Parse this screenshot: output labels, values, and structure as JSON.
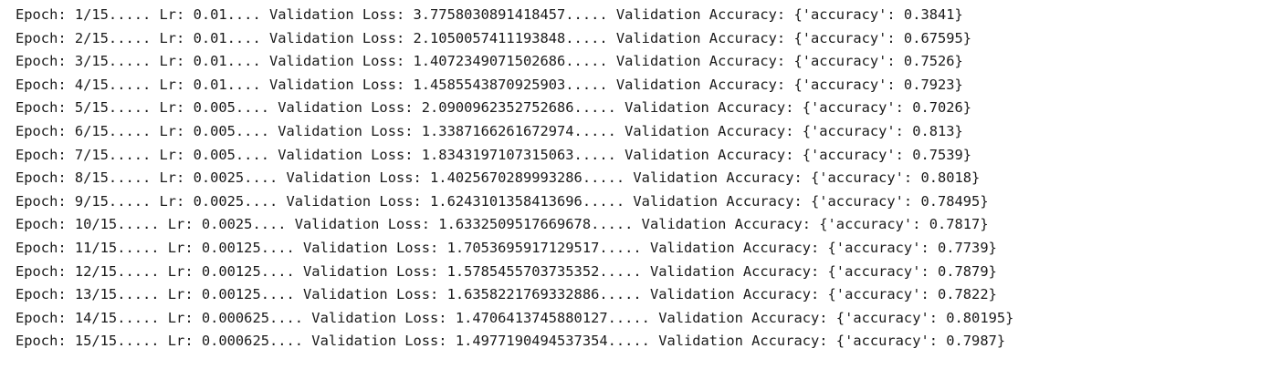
{
  "output": {
    "lines": [
      "Epoch: 1/15..... Lr: 0.01.... Validation Loss: 3.7758030891418457..... Validation Accuracy: {'accuracy': 0.3841}",
      "Epoch: 2/15..... Lr: 0.01.... Validation Loss: 2.1050057411193848..... Validation Accuracy: {'accuracy': 0.67595}",
      "Epoch: 3/15..... Lr: 0.01.... Validation Loss: 1.4072349071502686..... Validation Accuracy: {'accuracy': 0.7526}",
      "Epoch: 4/15..... Lr: 0.01.... Validation Loss: 1.4585543870925903..... Validation Accuracy: {'accuracy': 0.7923}",
      "Epoch: 5/15..... Lr: 0.005.... Validation Loss: 2.0900962352752686..... Validation Accuracy: {'accuracy': 0.7026}",
      "Epoch: 6/15..... Lr: 0.005.... Validation Loss: 1.3387166261672974..... Validation Accuracy: {'accuracy': 0.813}",
      "Epoch: 7/15..... Lr: 0.005.... Validation Loss: 1.8343197107315063..... Validation Accuracy: {'accuracy': 0.7539}",
      "Epoch: 8/15..... Lr: 0.0025.... Validation Loss: 1.4025670289993286..... Validation Accuracy: {'accuracy': 0.8018}",
      "Epoch: 9/15..... Lr: 0.0025.... Validation Loss: 1.6243101358413696..... Validation Accuracy: {'accuracy': 0.78495}",
      "Epoch: 10/15..... Lr: 0.0025.... Validation Loss: 1.6332509517669678..... Validation Accuracy: {'accuracy': 0.7817}",
      "Epoch: 11/15..... Lr: 0.00125.... Validation Loss: 1.7053695917129517..... Validation Accuracy: {'accuracy': 0.7739}",
      "Epoch: 12/15..... Lr: 0.00125.... Validation Loss: 1.5785455703735352..... Validation Accuracy: {'accuracy': 0.7879}",
      "Epoch: 13/15..... Lr: 0.00125.... Validation Loss: 1.6358221769332886..... Validation Accuracy: {'accuracy': 0.7822}",
      "Epoch: 14/15..... Lr: 0.000625.... Validation Loss: 1.4706413745880127..... Validation Accuracy: {'accuracy': 0.80195}",
      "Epoch: 15/15..... Lr: 0.000625.... Validation Loss: 1.4977190494537354..... Validation Accuracy: {'accuracy': 0.7987}"
    ]
  },
  "colors": {
    "background": "#ffffff",
    "text": "#1a1a1a"
  }
}
